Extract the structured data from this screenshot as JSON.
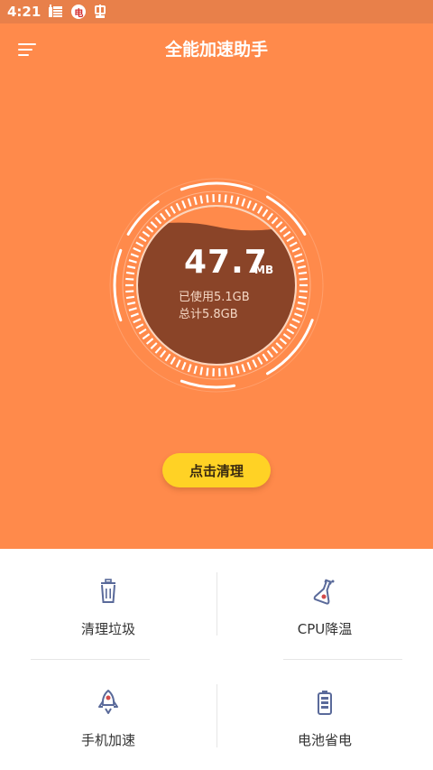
{
  "status_bar": {
    "time": "4:21",
    "icons": [
      "bomb-notification-icon",
      "badge-notification-icon",
      "bug-notification-icon"
    ],
    "badge_text": "电"
  },
  "app_bar": {
    "title": "全能加速助手"
  },
  "memory": {
    "value": "47.7",
    "unit": "MB",
    "used_text": "已使用5.1GB",
    "total_text": "总计5.8GB",
    "used_fraction": 0.88
  },
  "clean_button": {
    "label": "点击清理"
  },
  "features": [
    {
      "label": "清理垃圾",
      "icon": "trash-icon"
    },
    {
      "label": "CPU降温",
      "icon": "thermometer-icon"
    },
    {
      "label": "手机加速",
      "icon": "rocket-icon"
    },
    {
      "label": "电池省电",
      "icon": "battery-icon"
    }
  ],
  "colors": {
    "hero": "#ff8a4b",
    "status_bar": "#e8804a",
    "gauge_fill": "#8a4428",
    "button": "#ffd225",
    "icon": "#5a6a9a"
  }
}
